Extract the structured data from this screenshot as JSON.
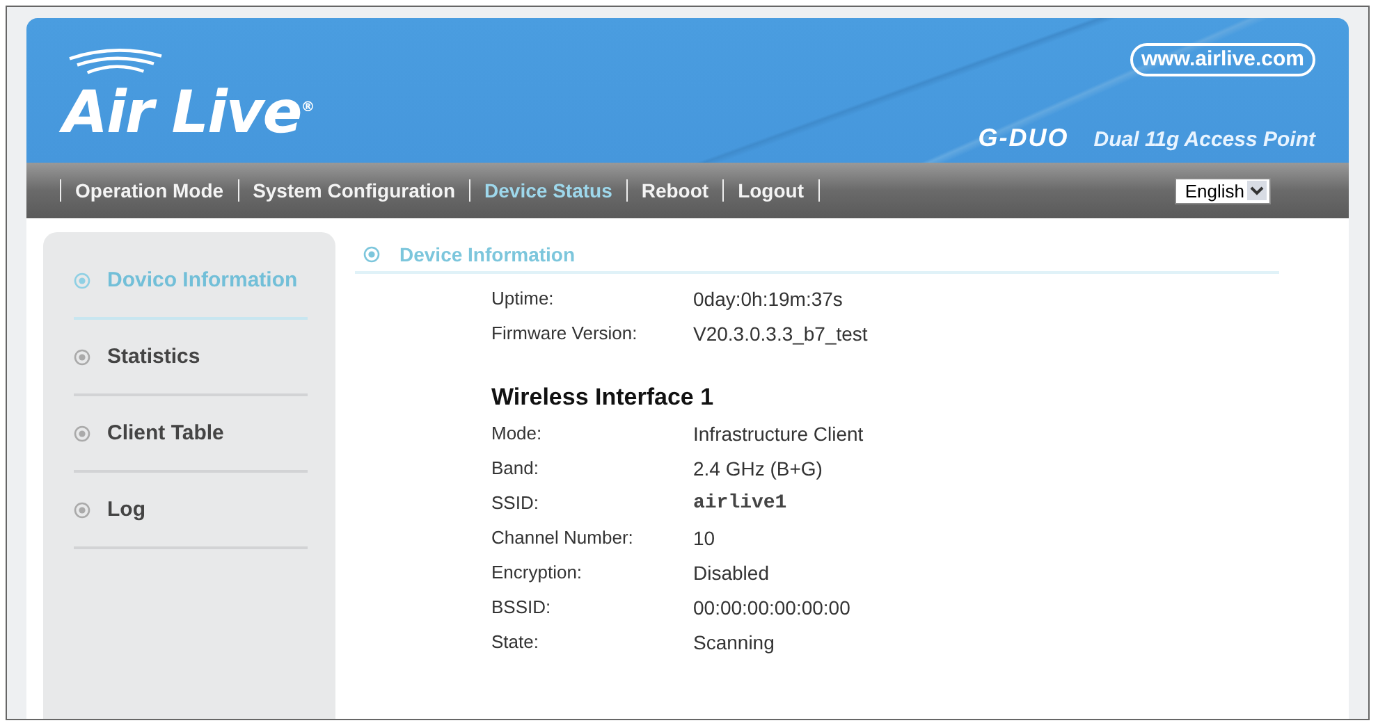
{
  "header": {
    "logo": "Air Live$^{®}$",
    "website": "www.airlive.com",
    "model": "G-DUO",
    "product": "Dual 11g Access Point"
  },
  "nav": {
    "items": [
      {
        "label": "Operation Mode",
        "selected": false
      },
      {
        "label": "System Configuration",
        "selected": false
      },
      {
        "label": "Device Status",
        "selected": true
      },
      {
        "label": "Reboot",
        "selected": false
      },
      {
        "label": "Logout",
        "selected": false
      }
    ],
    "language": "English"
  },
  "sidebar": {
    "items": [
      {
        "label": "Dovico Information",
        "selected": true
      },
      {
        "label": "Statistics",
        "selected": false
      },
      {
        "label": "Client Table",
        "selected": false
      },
      {
        "label": "Log",
        "selected": false
      }
    ]
  },
  "content": {
    "title": "Device Information",
    "general": [
      {
        "label": "Uptime:",
        "value": "0day:0h:19m:37s"
      },
      {
        "label": "Firmware Version:",
        "value": "V20.3.0.3.3_b7_test"
      }
    ],
    "wireless_title": "Wireless Interface 1",
    "wireless": [
      {
        "label": "Mode:",
        "value": "Infrastructure Client",
        "kind": "text"
      },
      {
        "label": "Band:",
        "value": "2.4 GHz (B+G)",
        "kind": "text"
      },
      {
        "label": "SSID:",
        "value": "airlive1",
        "kind": "mono"
      },
      {
        "label": "Channel Number:",
        "value": "10",
        "kind": "text"
      },
      {
        "label": "Encryption:",
        "value": "Disabled",
        "kind": "text"
      },
      {
        "label": "BSSID:",
        "value": "00:00:00:00:00:00",
        "kind": "text"
      },
      {
        "label": "State:",
        "value": "Scanning",
        "kind": "text"
      }
    ]
  }
}
